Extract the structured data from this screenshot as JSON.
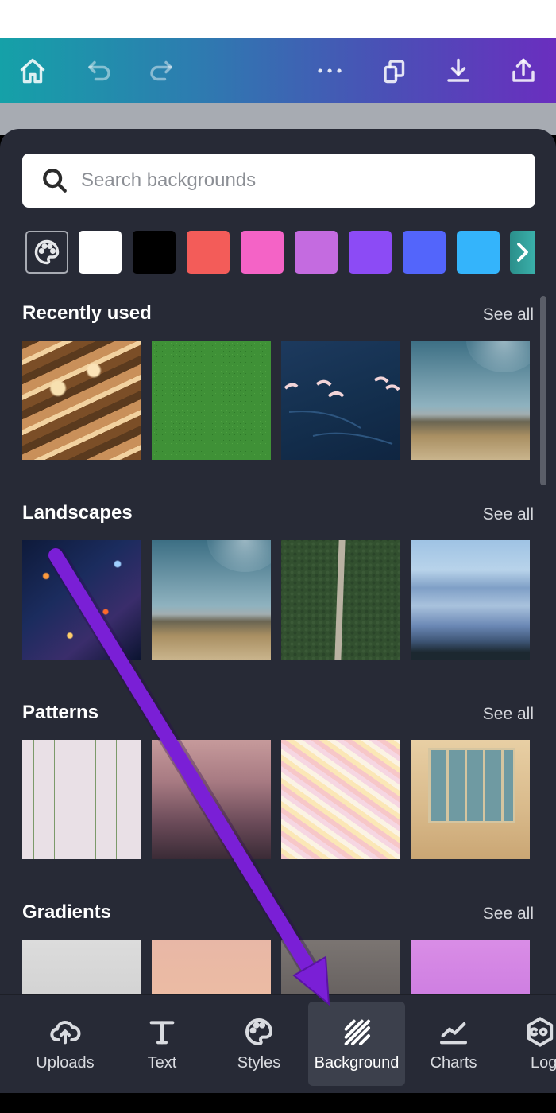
{
  "toolbar": {
    "icons": [
      "home-icon",
      "undo-icon",
      "redo-icon",
      "more-icon",
      "pages-icon",
      "download-icon",
      "share-icon"
    ]
  },
  "search": {
    "placeholder": "Search backgrounds"
  },
  "swatches": {
    "colors": [
      "#ffffff",
      "#000000",
      "#f35c59",
      "#f463c6",
      "#c46be0",
      "#8c4bf5",
      "#5365fb",
      "#34b4fb"
    ],
    "next_icon": "chevron-right-icon",
    "palette_icon": "palette-icon"
  },
  "sections": [
    {
      "title": "Recently used",
      "see_all": "See all"
    },
    {
      "title": "Landscapes",
      "see_all": "See all"
    },
    {
      "title": "Patterns",
      "see_all": "See all"
    },
    {
      "title": "Gradients",
      "see_all": "See all"
    }
  ],
  "bottom_tabs": [
    {
      "label": "Uploads",
      "icon": "upload-cloud-icon"
    },
    {
      "label": "Text",
      "icon": "text-icon"
    },
    {
      "label": "Styles",
      "icon": "palette-icon"
    },
    {
      "label": "Background",
      "icon": "background-stripes-icon",
      "active": true
    },
    {
      "label": "Charts",
      "icon": "chart-icon"
    },
    {
      "label": "Log",
      "icon": "logo-icon"
    }
  ],
  "colors": {
    "sheet_bg": "#272a36",
    "annotation_arrow": "#7a1fd6"
  }
}
